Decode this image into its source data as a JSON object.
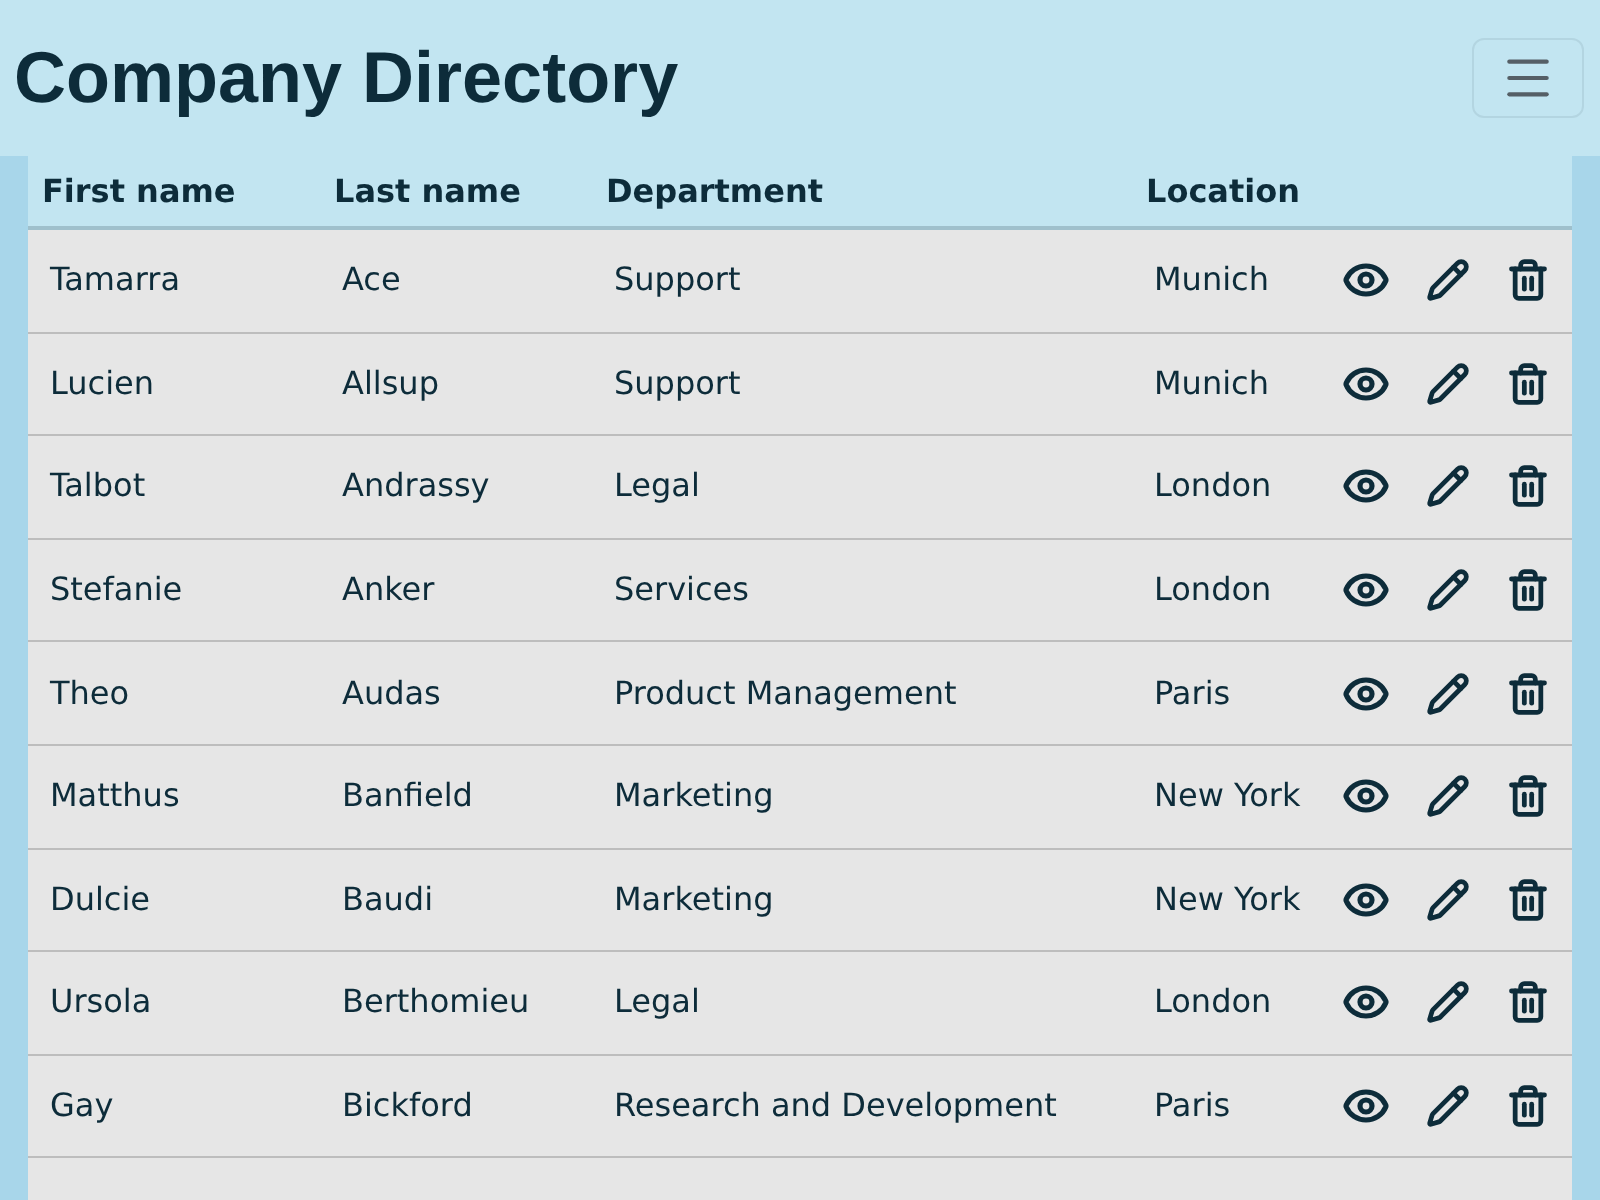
{
  "header": {
    "title": "Company Directory"
  },
  "table": {
    "columns": [
      "First name",
      "Last name",
      "Department",
      "Location"
    ],
    "rows": [
      {
        "first": "Tamarra",
        "last": "Ace",
        "department": "Support",
        "location": "Munich"
      },
      {
        "first": "Lucien",
        "last": "Allsup",
        "department": "Support",
        "location": "Munich"
      },
      {
        "first": "Talbot",
        "last": "Andrassy",
        "department": "Legal",
        "location": "London"
      },
      {
        "first": "Stefanie",
        "last": "Anker",
        "department": "Services",
        "location": "London"
      },
      {
        "first": "Theo",
        "last": "Audas",
        "department": "Product Management",
        "location": "Paris"
      },
      {
        "first": "Matthus",
        "last": "Banfield",
        "department": "Marketing",
        "location": "New York"
      },
      {
        "first": "Dulcie",
        "last": "Baudi",
        "department": "Marketing",
        "location": "New York"
      },
      {
        "first": "Ursola",
        "last": "Berthomieu",
        "department": "Legal",
        "location": "London"
      },
      {
        "first": "Gay",
        "last": "Bickford",
        "department": "Research and Development",
        "location": "Paris"
      }
    ]
  }
}
